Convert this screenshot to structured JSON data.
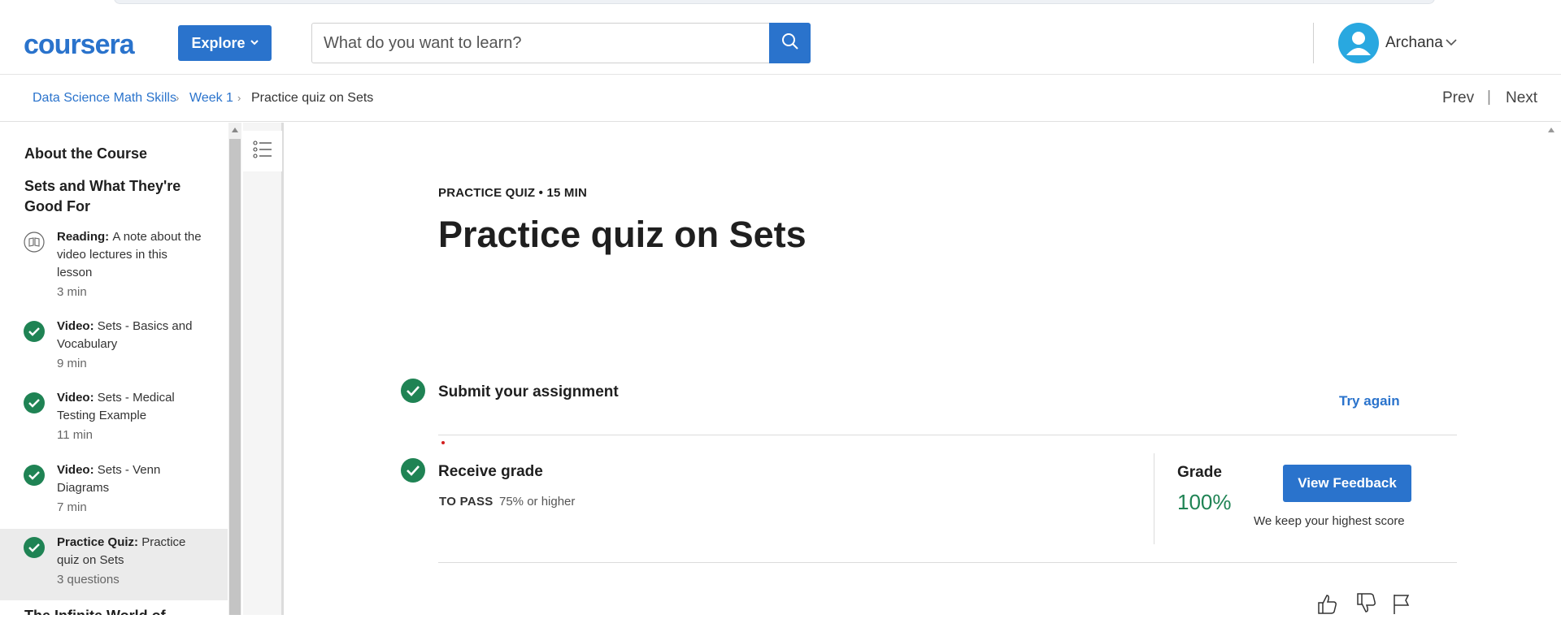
{
  "header": {
    "logo_text": "coursera",
    "explore_label": "Explore",
    "search_placeholder": "What do you want to learn?",
    "user_name": "Archana"
  },
  "breadcrumb": {
    "items": [
      "Data Science Math Skills",
      "Week 1",
      "Practice quiz on Sets"
    ],
    "prev_label": "Prev",
    "next_label": "Next",
    "nav_separator": "|"
  },
  "sidebar": {
    "heading_about": "About the Course",
    "heading_section": "Sets and What They're Good For",
    "items": [
      {
        "type": "Reading:",
        "title": "A note about the video lectures in this lesson",
        "duration": "3 min",
        "icon": "book-icon",
        "completed": false
      },
      {
        "type": "Video:",
        "title": "Sets - Basics and Vocabulary",
        "duration": "9 min",
        "icon": "check-icon",
        "completed": true
      },
      {
        "type": "Video:",
        "title": "Sets - Medical Testing Example",
        "duration": "11 min",
        "icon": "check-icon",
        "completed": true
      },
      {
        "type": "Video:",
        "title": "Sets - Venn Diagrams",
        "duration": "7 min",
        "icon": "check-icon",
        "completed": true
      },
      {
        "type": "Practice Quiz:",
        "title": "Practice quiz on Sets",
        "duration": "3 questions",
        "icon": "check-icon",
        "completed": true
      }
    ],
    "next_heading": "The Infinite World of"
  },
  "main": {
    "eyebrow": "PRACTICE QUIZ • 15 MIN",
    "title": "Practice quiz on Sets",
    "submit_title": "Submit your assignment",
    "try_again_label": "Try again",
    "receive_title": "Receive grade",
    "to_pass_label": "TO PASS",
    "to_pass_value": "75% or higher",
    "grade_label": "Grade",
    "grade_value": "100%",
    "view_feedback_label": "View Feedback",
    "keep_note": "We keep your highest score"
  },
  "colors": {
    "brand_blue": "#2a73cc",
    "success_green": "#1f8354",
    "avatar_blue": "#29a8e0"
  }
}
